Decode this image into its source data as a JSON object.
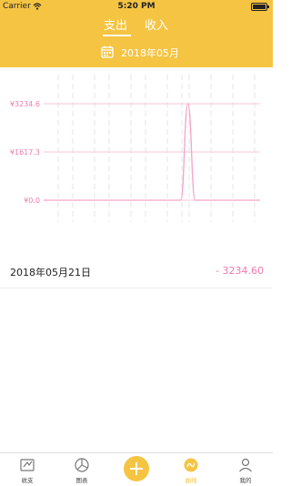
{
  "status_bar": {
    "carrier": "Carrier",
    "time": "5:20 PM"
  },
  "tabs": [
    {
      "label": "支出"
    },
    {
      "label": "收入"
    }
  ],
  "month": "2018年05月",
  "chart_data": {
    "type": "line",
    "yticks": [
      "¥3234.6",
      "¥1617.3",
      "¥0.0"
    ],
    "ylim": [
      0,
      3234.6
    ],
    "series": [
      {
        "values": [
          0,
          0,
          0,
          0,
          0,
          0,
          0,
          0,
          0,
          0,
          0,
          0,
          0,
          0,
          0,
          0,
          0,
          0,
          0,
          0,
          3234.6,
          0,
          0,
          0,
          0,
          0,
          0,
          0,
          0,
          0,
          0
        ]
      }
    ],
    "colors": {
      "line": "#F5A3C7",
      "grid": "#F8C5DA",
      "vgrid": "#E6E6E6",
      "tick_text": "#F07AAD"
    }
  },
  "records": [
    {
      "date": "2018年05月21日",
      "amount": "- 3234.60"
    }
  ],
  "tabbar": [
    {
      "label": "收支",
      "icon": "ledger-icon"
    },
    {
      "label": "图表",
      "icon": "pie-chart-icon"
    },
    {
      "label": "",
      "icon": "plus-icon"
    },
    {
      "label": "曲线",
      "icon": "curve-icon"
    },
    {
      "label": "我的",
      "icon": "person-icon"
    }
  ]
}
